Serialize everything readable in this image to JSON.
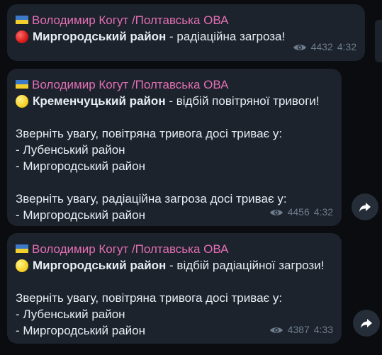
{
  "messages": [
    {
      "author": "Володимир Когут /Полтавська ОВА",
      "status_color": "red",
      "region": "Миргородський район",
      "event": " - радіаційна загроза!",
      "views": "4432",
      "time": "4:32",
      "body": []
    },
    {
      "author": "Володимир Когут /Полтавська ОВА",
      "status_color": "yellow",
      "region": "Кременчуцький район",
      "event": " - відбій повітряної тривоги!",
      "views": "4456",
      "time": "4:32",
      "body": [
        "",
        "Зверніть увагу, повітряна тривога досі триває у:",
        "- Лубенський район",
        "- Миргородський район",
        "",
        "Зверніть увагу, радіаційна загроза досі триває у:",
        "- Миргородський район"
      ]
    },
    {
      "author": "Володимир Когут /Полтавська ОВА",
      "status_color": "yellow",
      "region": "Миргородський район",
      "event": " - відбій радіаційної загрози!",
      "views": "4387",
      "time": "4:33",
      "body": [
        "",
        "Зверніть увагу, повітряна тривога досі триває у:",
        "- Лубенський район",
        "- Миргородський район"
      ]
    }
  ],
  "icons": {
    "flag": "ukraine-flag-icon",
    "views": "eye-icon",
    "share": "share-arrow-icon"
  },
  "colors": {
    "author": "#e36fb3",
    "bubble": "#1c232d",
    "text": "#e8edf3",
    "meta": "#6e7c8c",
    "background": "#0a0c0f"
  }
}
